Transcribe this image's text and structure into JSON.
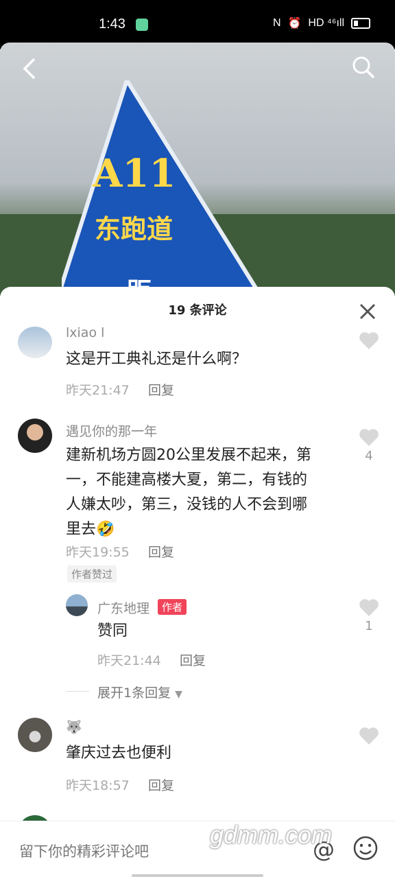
{
  "status": {
    "time": "1:43",
    "network": "HD ⁴⁶ıll"
  },
  "hero": {
    "sign_line1": "A11",
    "sign_line2": "东跑道",
    "sign_line3": "距"
  },
  "sheet": {
    "title": "19 条评论"
  },
  "comments": [
    {
      "user": "lxiao l",
      "text": "这是开工典礼还是什么啊？",
      "time": "昨天21:47",
      "reply": "回复"
    },
    {
      "user": "遇见你的那一年",
      "text_lines": [
        "建新机场方圆20公里发展不起来，第",
        "一，不能建高楼大夏，第二，有钱的",
        "人嫌太吵，第三，没钱的人不会到哪",
        "里去🤣"
      ],
      "time": "昨天19:55",
      "reply": "回复",
      "likes": "4",
      "tag": "作者赞过"
    },
    {
      "user": "广东地理",
      "badge": "作者",
      "text": "赞同",
      "time": "昨天21:44",
      "reply": "回复",
      "likes": "1"
    },
    {
      "user": "🐺",
      "text": "肇庆过去也便利",
      "time": "昨天18:57",
      "reply": "回复"
    }
  ],
  "expand": {
    "label": "展开1条回复"
  },
  "input": {
    "placeholder": "留下你的精彩评论吧",
    "at": "@"
  },
  "watermark": "gdmm.com"
}
